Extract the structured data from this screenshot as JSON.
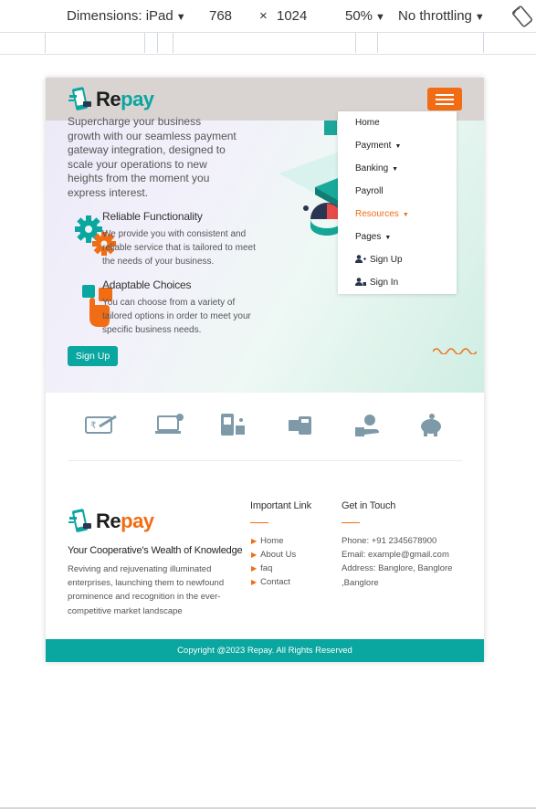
{
  "devtools": {
    "dimensions_label": "Dimensions: iPad",
    "width": "768",
    "times": "×",
    "height": "1024",
    "zoom": "50%",
    "throttling": "No throttling"
  },
  "header": {
    "logo": {
      "r": "Re",
      "p": "pay"
    }
  },
  "hero": {
    "text": "Supercharge your business growth with our seamless payment gateway integration, designed to scale your operations to new heights from the moment you express interest.",
    "features": [
      {
        "title": "Reliable Functionality",
        "desc": "We provide you with consistent and reliable service that is tailored to meet the needs of your business."
      },
      {
        "title": "Adaptable Choices",
        "desc": "You can choose from a variety of tailored options in order to meet your specific business needs."
      }
    ],
    "signup_label": "Sign Up"
  },
  "menu": {
    "items": [
      "Home",
      "Payment",
      "Banking",
      "Payroll",
      "Resources",
      "Pages",
      "Sign Up",
      "Sign In"
    ]
  },
  "services": {
    "icons": [
      "cheque-icon",
      "laptop-payment-icon",
      "mobile-wallet-icon",
      "card-calculator-icon",
      "hand-coin-icon",
      "piggy-bank-icon"
    ]
  },
  "footer": {
    "tagline": "Your Cooperative's Wealth of Knowledge",
    "description": "Reviving and rejuvenating illuminated enterprises, launching them to newfound prominence and recognition in the ever-competitive market landscape",
    "links_title": "Important Link",
    "links": [
      "Home",
      "About Us",
      "faq",
      "Contact"
    ],
    "contact_title": "Get in Touch",
    "phone": "Phone: +91 2345678900",
    "email": "Email: example@gmail.com",
    "address": "Address: Banglore, Banglore ,Banglore"
  },
  "copyright": "Copyright @2023 Repay. All Rights Reserved",
  "colors": {
    "brand_teal": "#0aa6a0",
    "accent_orange": "#f26c13",
    "header_bg": "#d9d4d1"
  }
}
